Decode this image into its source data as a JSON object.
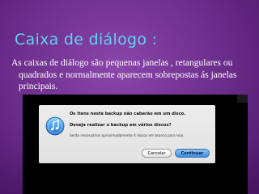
{
  "slide": {
    "title": "Caixa de diálogo :",
    "body_lines": [
      "As caixas de diálogo são pequenas janelas , retangulares",
      "ou quadrados e normalmente aparecem sobrepostas",
      "ás janelas principais."
    ]
  },
  "dialog": {
    "icon": "itunes-music-icon",
    "title": "Os itens neste backup não caberão em um disco.",
    "question": "Deseja realizar o backup em vários discos?",
    "info": "Serão necessários aproximadamente 4 discos em branco para isso.",
    "cancel_label": "Cancelar",
    "continue_label": "Continuar"
  },
  "colors": {
    "background": "#6b2d8a",
    "title": "#5fd3ee",
    "body_text": "#ffffff",
    "default_button": "#3f8fe6"
  }
}
